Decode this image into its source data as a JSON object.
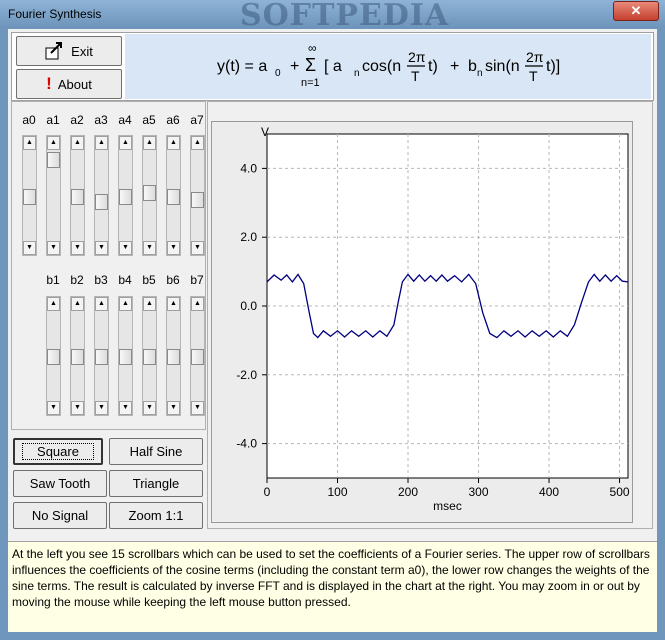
{
  "window": {
    "title": "Fourier Synthesis",
    "watermark": "SOFTPEDIA",
    "close_icon": "close-icon"
  },
  "buttons": {
    "exit_label": "Exit",
    "about_label": "About",
    "square_label": "Square",
    "half_sine_label": "Half Sine",
    "saw_tooth_label": "Saw Tooth",
    "triangle_label": "Triangle",
    "no_signal_label": "No Signal",
    "zoom_label": "Zoom 1:1"
  },
  "formula": {
    "lhs": "y(t) = a",
    "a0_sub": "0",
    "plus1": "+",
    "sum_top": "∞",
    "sum_sym": "Σ",
    "sum_bottom": "n=1",
    "bracket_open": "[ a",
    "an_sub": "n",
    "cos": "cos(n",
    "frac_num": "2π",
    "frac_den": "T",
    "t1": "t)",
    "plus2": "+",
    "b": "b",
    "bn_sub": "n",
    "sin": "sin(n",
    "t2": "t)]"
  },
  "sliders": {
    "cosine": [
      {
        "label": "a0",
        "value": 0.5
      },
      {
        "label": "a1",
        "value": 0.02
      },
      {
        "label": "a2",
        "value": 0.5
      },
      {
        "label": "a3",
        "value": 0.57
      },
      {
        "label": "a4",
        "value": 0.5
      },
      {
        "label": "a5",
        "value": 0.45
      },
      {
        "label": "a6",
        "value": 0.5
      },
      {
        "label": "a7",
        "value": 0.54
      }
    ],
    "sine": [
      {
        "label": "b1",
        "value": 0.5
      },
      {
        "label": "b2",
        "value": 0.5
      },
      {
        "label": "b3",
        "value": 0.5
      },
      {
        "label": "b4",
        "value": 0.5
      },
      {
        "label": "b5",
        "value": 0.5
      },
      {
        "label": "b6",
        "value": 0.5
      },
      {
        "label": "b7",
        "value": 0.5
      }
    ]
  },
  "chart_data": {
    "type": "line",
    "ylabel": "V",
    "xlabel": "msec",
    "xlim": [
      0,
      512
    ],
    "ylim": [
      -5,
      5
    ],
    "xticks": [
      0,
      100,
      200,
      300,
      400,
      500
    ],
    "xtick_labels": [
      "0",
      "100",
      "200",
      "300",
      "400",
      "500"
    ],
    "yticks": [
      4,
      2,
      0,
      -2,
      -4
    ],
    "ytick_labels": [
      "4.0",
      "2.0",
      "0.0",
      "-2.0",
      "-4.0"
    ],
    "grid": true,
    "series": [
      {
        "color": "#000080",
        "x": [
          0,
          10,
          20,
          28,
          36,
          44,
          52,
          60,
          66,
          72,
          80,
          90,
          100,
          110,
          120,
          130,
          140,
          150,
          160,
          170,
          180,
          186,
          192,
          200,
          208,
          216,
          224,
          232,
          240,
          248,
          256,
          266,
          276,
          286,
          296,
          306,
          316,
          326,
          336,
          346,
          356,
          366,
          376,
          386,
          396,
          406,
          416,
          426,
          436,
          446,
          456,
          464,
          472,
          480,
          488,
          496,
          504,
          512
        ],
        "y": [
          0.7,
          0.9,
          0.75,
          0.9,
          0.7,
          0.92,
          0.65,
          -0.2,
          -0.8,
          -0.92,
          -0.72,
          -0.88,
          -0.72,
          -0.9,
          -0.72,
          -0.88,
          -0.72,
          -0.9,
          -0.72,
          -0.88,
          -0.55,
          0.1,
          0.7,
          0.92,
          0.72,
          0.9,
          0.72,
          0.88,
          0.72,
          0.9,
          0.72,
          0.88,
          0.7,
          0.92,
          0.65,
          -0.2,
          -0.8,
          -0.92,
          -0.72,
          -0.88,
          -0.72,
          -0.9,
          -0.72,
          -0.88,
          -0.72,
          -0.9,
          -0.72,
          -0.88,
          -0.55,
          0.1,
          0.7,
          0.92,
          0.72,
          0.9,
          0.72,
          0.88,
          0.72,
          0.7
        ]
      }
    ]
  },
  "info_text": "At the left you see 15 scrollbars which can be used to set the coefficients of a Fourier series. The upper row of scrollbars influences the coefficients of the cosine terms (including the constant term a0), the lower row changes the weights of the sine terms. The result is calculated by inverse FFT and is displayed in the chart at the right. You may zoom in or out by moving the mouse while keeping the left mouse button pressed."
}
